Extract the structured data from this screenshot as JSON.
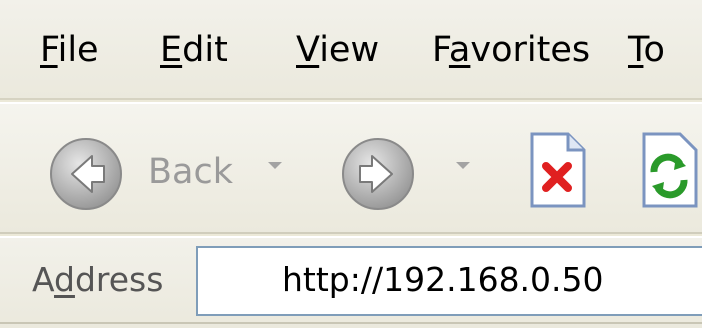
{
  "menu": {
    "items": [
      {
        "pre": "",
        "ul": "F",
        "post": "ile"
      },
      {
        "pre": "",
        "ul": "E",
        "post": "dit"
      },
      {
        "pre": "",
        "ul": "V",
        "post": "iew"
      },
      {
        "pre": "F",
        "ul": "a",
        "post": "vorites"
      },
      {
        "pre": "",
        "ul": "T",
        "post": "o"
      }
    ]
  },
  "toolbar": {
    "back_label": "Back",
    "back_icon": "back-arrow-icon",
    "forward_icon": "forward-arrow-icon",
    "stop_icon": "stop-icon",
    "refresh_icon": "refresh-icon"
  },
  "address": {
    "label_pre": "A",
    "label_ul": "d",
    "label_post": "dress",
    "value": "http://192.168.0.50"
  },
  "colors": {
    "chrome_bg": "#ece9d8",
    "field_border": "#7f9db9",
    "stop_red": "#e02020",
    "refresh_green": "#2a9a2a"
  }
}
